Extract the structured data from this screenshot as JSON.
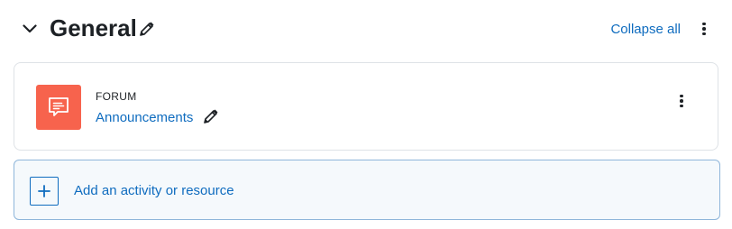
{
  "section": {
    "title": "General",
    "collapse_all_label": "Collapse all",
    "toggle_icon": "chevron-down-icon",
    "edit_icon": "pencil-icon",
    "menu_icon": "kebab-menu-icon"
  },
  "activity": {
    "type_label": "FORUM",
    "name": "Announcements",
    "icon": "forum-icon",
    "icon_color": "#f7634d",
    "edit_icon": "pencil-icon",
    "menu_icon": "kebab-menu-icon"
  },
  "add_activity": {
    "label": "Add an activity or resource",
    "icon": "plus-icon"
  },
  "colors": {
    "link": "#0f6cbf",
    "text": "#1d2125",
    "border": "#dee2e6",
    "add_border": "#8fb6da",
    "add_background": "#f5f9fc"
  }
}
